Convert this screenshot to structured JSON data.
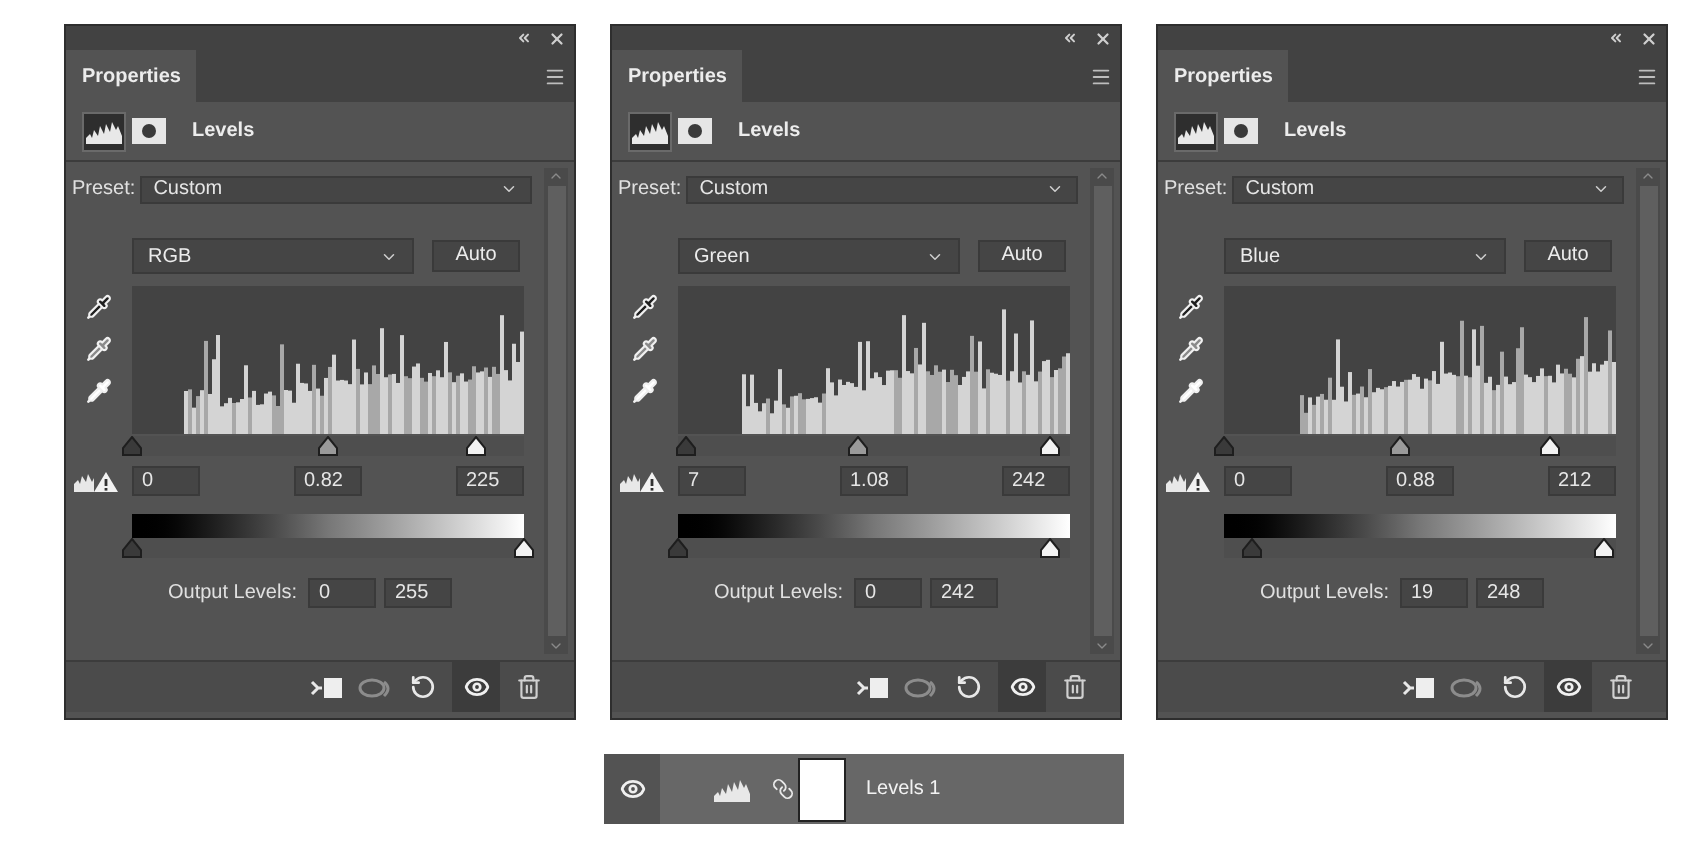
{
  "panels": [
    {
      "title": "Properties",
      "adjustment": "Levels",
      "preset_label": "Preset:",
      "preset": "Custom",
      "channel": "RGB",
      "auto_button": "Auto",
      "input_levels": [
        {
          "value": "0",
          "level": 0
        },
        {
          "value": "0.82",
          "level": 0.5
        },
        {
          "value": "225",
          "level": 0.88
        }
      ],
      "output_label": "Output Levels:",
      "output_levels": [
        {
          "value": "0",
          "level": 0
        },
        {
          "value": "255",
          "level": 1
        }
      ]
    },
    {
      "title": "Properties",
      "adjustment": "Levels",
      "preset_label": "Preset:",
      "preset": "Custom",
      "channel": "Green",
      "auto_button": "Auto",
      "input_levels": [
        {
          "value": "7",
          "level": 0.02
        },
        {
          "value": "1.08",
          "level": 0.46
        },
        {
          "value": "242",
          "level": 0.95
        }
      ],
      "output_label": "Output Levels:",
      "output_levels": [
        {
          "value": "0",
          "level": 0
        },
        {
          "value": "242",
          "level": 0.95
        }
      ]
    },
    {
      "title": "Properties",
      "adjustment": "Levels",
      "preset_label": "Preset:",
      "preset": "Custom",
      "channel": "Blue",
      "auto_button": "Auto",
      "input_levels": [
        {
          "value": "0",
          "level": 0
        },
        {
          "value": "0.88",
          "level": 0.45
        },
        {
          "value": "212",
          "level": 0.83
        }
      ],
      "output_label": "Output Levels:",
      "output_levels": [
        {
          "value": "19",
          "level": 0.07
        },
        {
          "value": "248",
          "level": 0.97
        }
      ]
    }
  ],
  "layer": {
    "name": "Levels 1",
    "visible": true
  }
}
